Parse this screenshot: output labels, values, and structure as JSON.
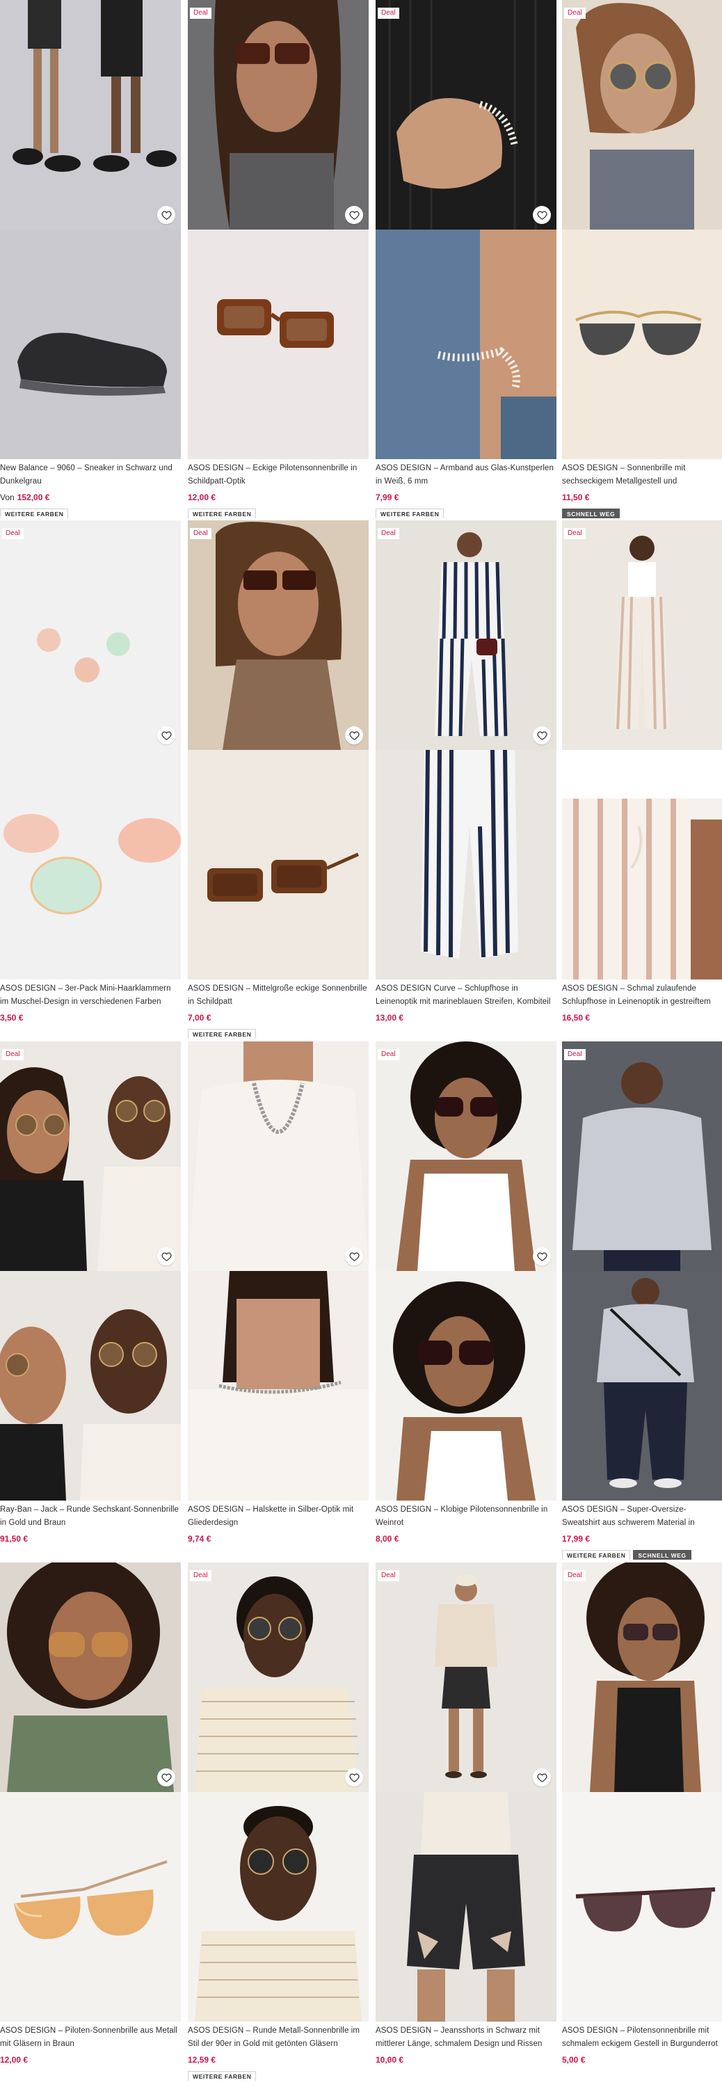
{
  "deal_label": "Deal",
  "colors": {
    "price_red": "#d01345",
    "text": "#2d2d2d"
  },
  "products": [
    {
      "deal": false,
      "title": "New Balance – 9060 – Sneaker in Schwarz und Dunkelgrau",
      "price_prefix": "Von",
      "price": "152,00 €",
      "tags": [
        "WEITERE FARBEN"
      ]
    },
    {
      "deal": true,
      "title": "ASOS DESIGN – Eckige Pilotensonnenbrille in Schildpatt-Optik",
      "price_prefix": "",
      "price": "12,00 €",
      "tags": [
        "WEITERE FARBEN"
      ]
    },
    {
      "deal": true,
      "title": "ASOS DESIGN – Armband aus Glas-Kunstperlen in Weiß, 6 mm",
      "price_prefix": "",
      "price": "7,99 €",
      "tags": [
        "WEITERE FARBEN"
      ]
    },
    {
      "deal": true,
      "title": "ASOS DESIGN – Sonnenbrille mit sechseckigem Metallgestell und polarisierten Gläsern",
      "price_prefix": "",
      "price": "11,50 €",
      "tags": [
        "SCHNELL WEG"
      ]
    },
    {
      "deal": true,
      "title": "ASOS DESIGN – 3er-Pack Mini-Haarklammern im Muschel-Design in verschiedenen Farben",
      "price_prefix": "",
      "price": "3,50 €",
      "tags": []
    },
    {
      "deal": true,
      "title": "ASOS DESIGN – Mittelgroße eckige Sonnenbrille in Schildpatt",
      "price_prefix": "",
      "price": "7,00 €",
      "tags": [
        "WEITERE FARBEN"
      ]
    },
    {
      "deal": true,
      "title": "ASOS DESIGN Curve – Schlupfhose in Leinenoptik mit marineblauen Streifen, Kombiteil",
      "price_prefix": "",
      "price": "13,00 €",
      "tags": []
    },
    {
      "deal": true,
      "title": "ASOS DESIGN – Schmal zulaufende Schlupfhose in Leinenoptik in gestreiftem Nerzbraun",
      "price_prefix": "",
      "price": "16,50 €",
      "tags": []
    },
    {
      "deal": true,
      "title": "Ray-Ban – Jack – Runde Sechskant-Sonnenbrille in Gold und Braun",
      "price_prefix": "",
      "price": "91,50 €",
      "tags": []
    },
    {
      "deal": false,
      "title": "ASOS DESIGN – Halskette in Silber-Optik mit Gliederdesign",
      "price_prefix": "",
      "price": "9,74 €",
      "tags": []
    },
    {
      "deal": true,
      "title": "ASOS DESIGN – Klobige Pilotensonnenbrille in Weinrot",
      "price_prefix": "",
      "price": "8,00 €",
      "tags": []
    },
    {
      "deal": true,
      "title": "ASOS DESIGN – Super-Oversize-Sweatshirt aus schwerem Material in Neoprenoptik in Grau meliert",
      "price_prefix": "",
      "price": "17,99 €",
      "tags": [
        "WEITERE FARBEN",
        "SCHNELL WEG"
      ]
    },
    {
      "deal": false,
      "title": "ASOS DESIGN – Piloten-Sonnenbrille aus Metall mit Gläsern in Braun",
      "price_prefix": "",
      "price": "12,00 €",
      "tags": []
    },
    {
      "deal": true,
      "title": "ASOS DESIGN – Runde Metall-Sonnenbrille im Stil der 90er in Gold mit getönten Gläsern",
      "price_prefix": "",
      "price": "12,59 €",
      "tags": [
        "WEITERE FARBEN"
      ]
    },
    {
      "deal": true,
      "title": "ASOS DESIGN – Jeansshorts in Schwarz mit mittlerer Länge, schmalem Design und Rissen",
      "price_prefix": "",
      "price": "10,00 €",
      "tags": []
    },
    {
      "deal": true,
      "title": "ASOS DESIGN – Pilotensonnenbrille mit schmalem eckigem Gestell in Burgunderrot",
      "price_prefix": "",
      "price": "5,00 €",
      "tags": []
    }
  ]
}
